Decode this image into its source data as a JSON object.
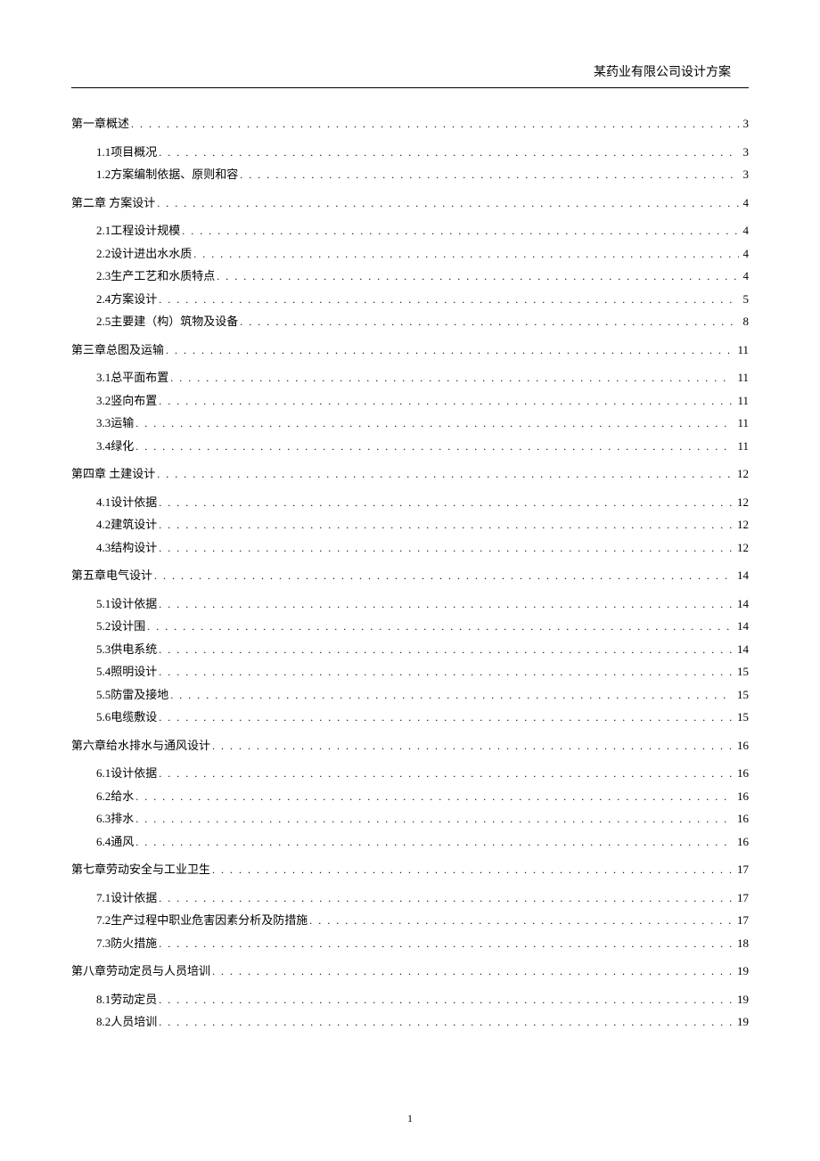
{
  "header_title": "某药业有限公司设计方案",
  "page_number": "1",
  "toc": [
    {
      "level": 1,
      "title": "第一章概述",
      "page": "3"
    },
    {
      "level": 2,
      "title": "1.1项目概况",
      "page": "3"
    },
    {
      "level": 2,
      "title": "1.2方案编制依据、原则和容",
      "page": "3"
    },
    {
      "level": 1,
      "title": "第二章 方案设计",
      "page": "4"
    },
    {
      "level": 2,
      "title": "2.1工程设计规模",
      "page": "4"
    },
    {
      "level": 2,
      "title": "2.2设计进出水水质",
      "page": "4"
    },
    {
      "level": 2,
      "title": "2.3生产工艺和水质特点",
      "page": "4"
    },
    {
      "level": 2,
      "title": "2.4方案设计",
      "page": "5"
    },
    {
      "level": 2,
      "title": "2.5主要建（构）筑物及设备",
      "page": "8"
    },
    {
      "level": 1,
      "title": "第三章总图及运输",
      "page": "11"
    },
    {
      "level": 2,
      "title": "3.1总平面布置",
      "page": "11"
    },
    {
      "level": 2,
      "title": "3.2竖向布置",
      "page": "11"
    },
    {
      "level": 2,
      "title": "3.3运输",
      "page": "11"
    },
    {
      "level": 2,
      "title": "3.4绿化",
      "page": "11"
    },
    {
      "level": 1,
      "title": "第四章 土建设计",
      "page": "12"
    },
    {
      "level": 2,
      "title": "4.1设计依据",
      "page": "12"
    },
    {
      "level": 2,
      "title": "4.2建筑设计",
      "page": "12"
    },
    {
      "level": 2,
      "title": "4.3结构设计",
      "page": "12"
    },
    {
      "level": 1,
      "title": "第五章电气设计",
      "page": "14"
    },
    {
      "level": 2,
      "title": "5.1设计依据",
      "page": "14"
    },
    {
      "level": 2,
      "title": "5.2设计围",
      "page": "14"
    },
    {
      "level": 2,
      "title": "5.3供电系统",
      "page": "14"
    },
    {
      "level": 2,
      "title": "5.4照明设计",
      "page": "15"
    },
    {
      "level": 2,
      "title": "5.5防雷及接地",
      "page": "15"
    },
    {
      "level": 2,
      "title": "5.6电缆敷设",
      "page": "15"
    },
    {
      "level": 1,
      "title": "第六章给水排水与通风设计",
      "page": "16"
    },
    {
      "level": 2,
      "title": "6.1设计依据",
      "page": "16"
    },
    {
      "level": 2,
      "title": "6.2给水",
      "page": "16"
    },
    {
      "level": 2,
      "title": "6.3排水",
      "page": "16"
    },
    {
      "level": 2,
      "title": "6.4通风",
      "page": "16"
    },
    {
      "level": 1,
      "title": "第七章劳动安全与工业卫生",
      "page": "17"
    },
    {
      "level": 2,
      "title": "7.1设计依据",
      "page": "17"
    },
    {
      "level": 2,
      "title": "7.2生产过程中职业危害因素分析及防措施",
      "page": "17"
    },
    {
      "level": 2,
      "title": "7.3防火措施",
      "page": "18"
    },
    {
      "level": 1,
      "title": "第八章劳动定员与人员培训",
      "page": "19"
    },
    {
      "level": 2,
      "title": "8.1劳动定员",
      "page": "19"
    },
    {
      "level": 2,
      "title": "8.2人员培训",
      "page": "19"
    }
  ]
}
